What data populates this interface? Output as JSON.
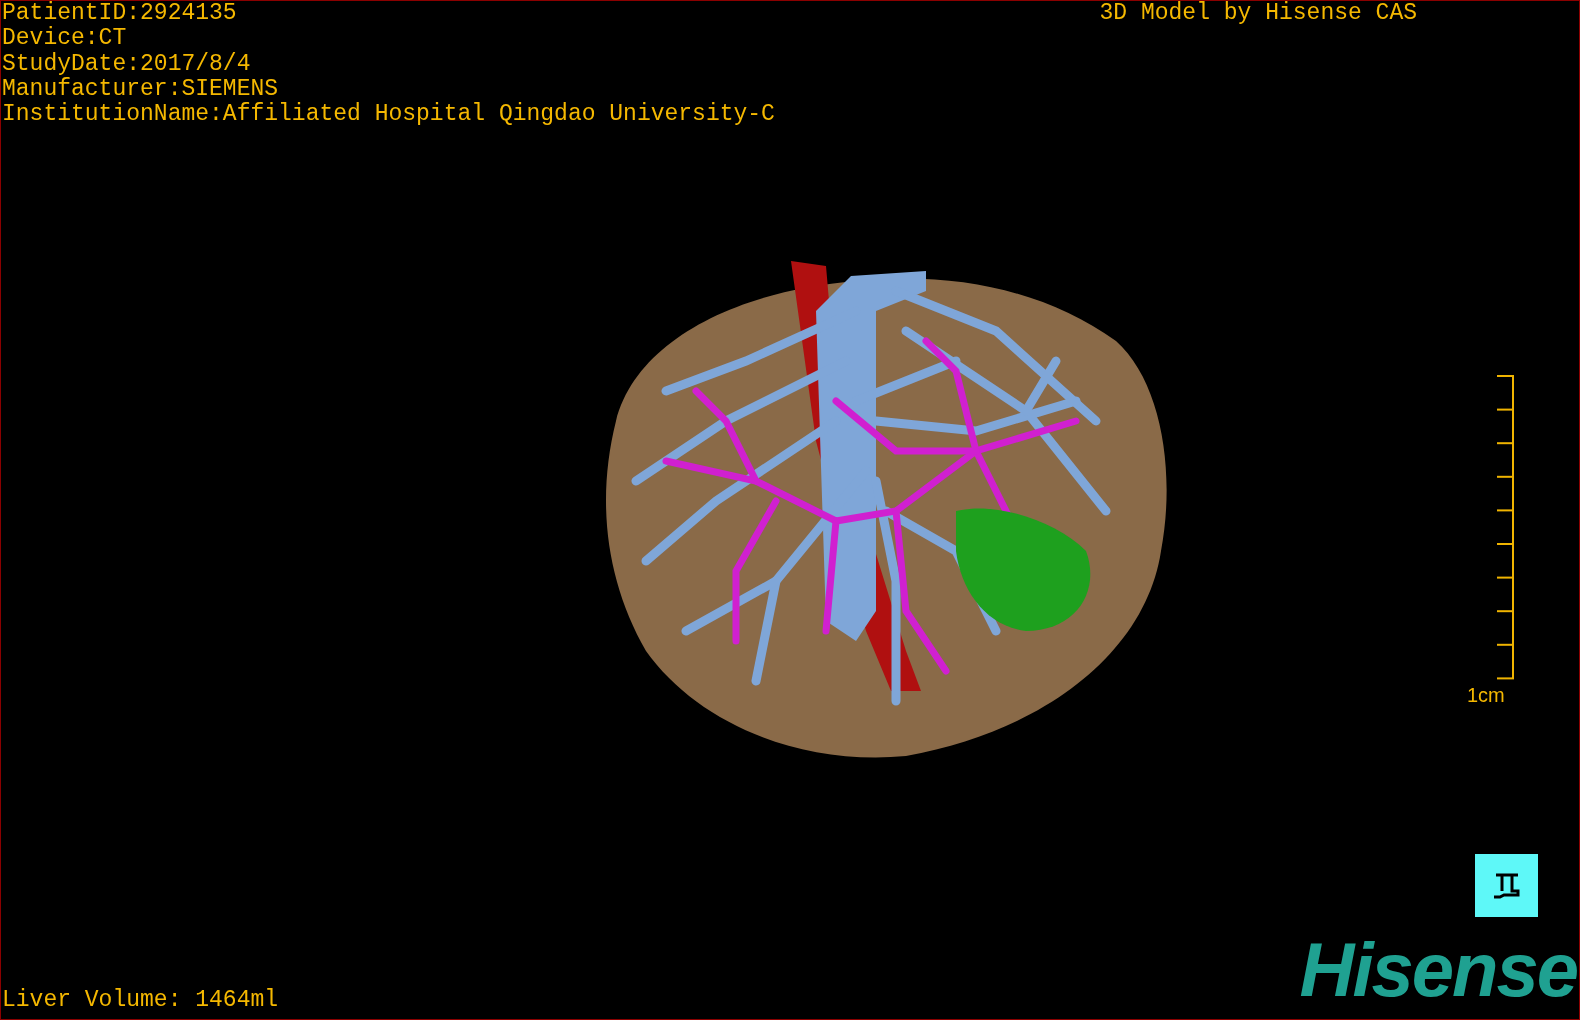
{
  "overlay": {
    "info_lines": [
      "PatientID:2924135",
      "Device:CT",
      "StudyDate:2017/8/4",
      "Manufacturer:SIEMENS",
      "InstitutionName:Affiliated Hospital Qingdao University-C"
    ],
    "title": "3D Model by Hisense CAS"
  },
  "scale": {
    "label": "1cm"
  },
  "volume": "Liver Volume: 1464ml",
  "logo": "Hisense"
}
